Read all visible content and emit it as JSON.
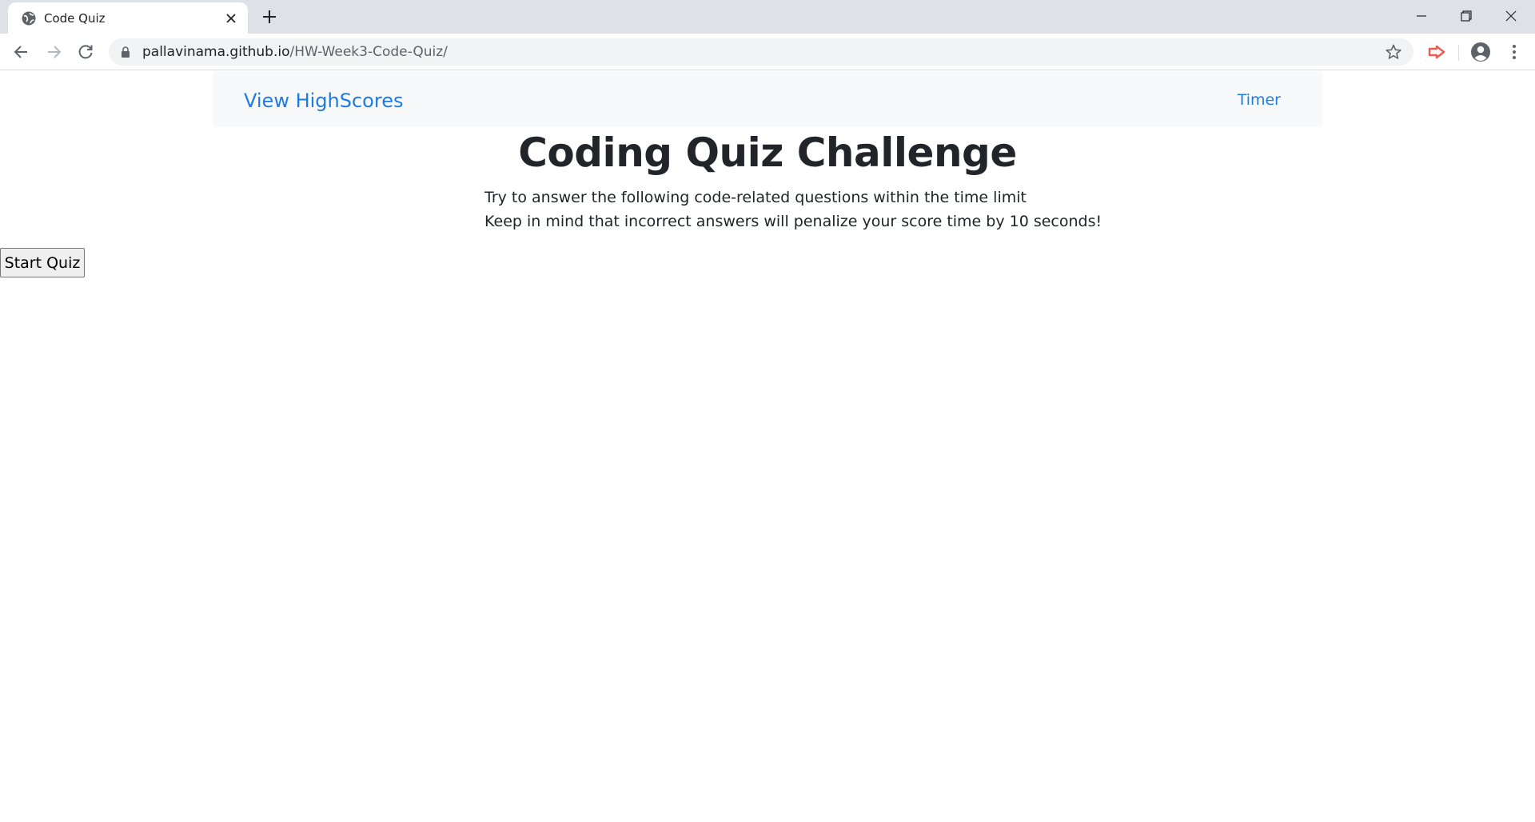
{
  "browser": {
    "tab_title": "Code Quiz",
    "url_host": "pallavinama.github.io",
    "url_path": "/HW-Week3-Code-Quiz/"
  },
  "navbar": {
    "highscores_link": "View HighScores",
    "timer_label": "Timer"
  },
  "main": {
    "title": "Coding Quiz Challenge",
    "intro_line_1": "Try to answer the following code-related questions within the time limit",
    "intro_line_2": "Keep in mind that incorrect answers will penalize your score time by 10 seconds!",
    "start_button": "Start Quiz"
  },
  "colors": {
    "link": "#1e7be3",
    "navbar_bg": "#f8f9fa",
    "text": "#212529",
    "tabstrip_bg": "#dee1e6"
  },
  "icons": [
    "globe-icon",
    "close-icon",
    "plus-icon",
    "minimize-icon",
    "restore-icon",
    "window-close-icon",
    "back-arrow-icon",
    "forward-arrow-icon",
    "reload-icon",
    "lock-icon",
    "star-icon",
    "extension-icon",
    "profile-icon",
    "kebab-menu-icon"
  ]
}
